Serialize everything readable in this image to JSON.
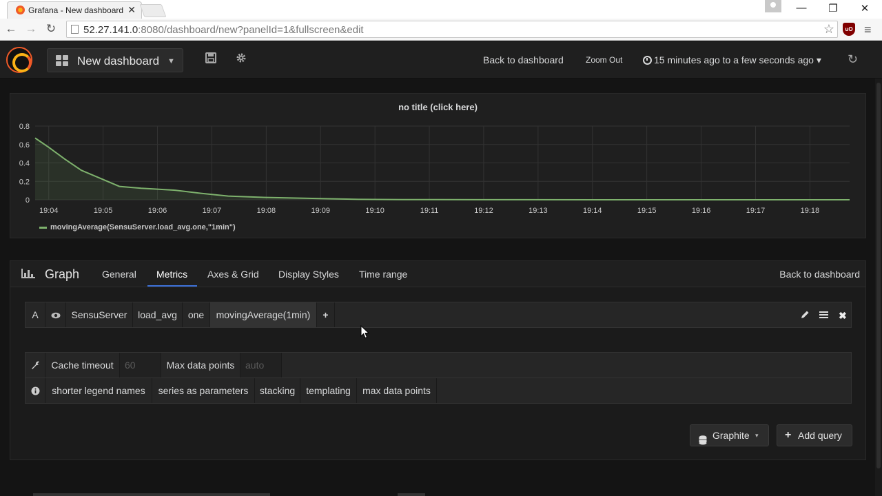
{
  "browser": {
    "tab_title": "Grafana - New dashboard",
    "tab_close": "✕",
    "url_host": "52.27.141.0",
    "url_rest": ":8080/dashboard/new?panelId=1&fullscreen&edit",
    "ublock_label": "uO",
    "window_controls": {
      "minimize": "—",
      "restore": "❐",
      "close": "✕"
    },
    "nav": {
      "back": "←",
      "forward": "→",
      "reload": "↻",
      "star": "☆",
      "menu": "≡"
    }
  },
  "topnav": {
    "dashboard_title": "New dashboard",
    "caret": "▼",
    "save_icon": "floppy-disk-icon",
    "settings_icon": "gear-icon",
    "back_to_dashboard": "Back to dashboard",
    "zoom_out": "Zoom Out",
    "time_range": "15 minutes ago to a few seconds ago",
    "time_caret": "▾",
    "refresh_icon": "↻"
  },
  "panel": {
    "title": "no title (click here)",
    "legend": "movingAverage(SensuServer.load_avg.one,\"1min\")"
  },
  "chart_data": {
    "type": "area",
    "title": "no title (click here)",
    "xlabel": "",
    "ylabel": "",
    "ylim": [
      0,
      0.8
    ],
    "y_ticks": [
      "0",
      "0.2",
      "0.4",
      "0.6",
      "0.8"
    ],
    "x_ticks": [
      "19:04",
      "19:05",
      "19:06",
      "19:07",
      "19:08",
      "19:09",
      "19:10",
      "19:11",
      "19:12",
      "19:13",
      "19:14",
      "19:15",
      "19:16",
      "19:17",
      "19:18"
    ],
    "x_range_minutes": [
      -0.25,
      14.73
    ],
    "grid": true,
    "legend_position": "bottom-left",
    "series": [
      {
        "name": "movingAverage(SensuServer.load_avg.one,\"1min\")",
        "color": "#7eb26d",
        "x": [
          -0.25,
          0.0,
          0.3,
          0.6,
          1.0,
          1.3,
          1.7,
          2.3,
          2.8,
          3.3,
          4.0,
          5.0,
          5.7,
          6.5,
          8.0,
          10.0,
          12.0,
          14.73
        ],
        "y": [
          0.67,
          0.57,
          0.44,
          0.32,
          0.22,
          0.145,
          0.125,
          0.105,
          0.07,
          0.04,
          0.025,
          0.013,
          0.005,
          0.002,
          0.001,
          0.0,
          0.0,
          0.0
        ]
      }
    ]
  },
  "editor": {
    "title": "Graph",
    "tabs": [
      "General",
      "Metrics",
      "Axes & Grid",
      "Display Styles",
      "Time range"
    ],
    "active_tab": "Metrics",
    "back_to_dashboard": "Back to dashboard",
    "query": {
      "ref": "A",
      "segments": [
        "SensuServer",
        "load_avg",
        "one"
      ],
      "function": "movingAverage(1min)",
      "add": "+"
    },
    "options": {
      "cache_timeout_label": "Cache timeout",
      "cache_timeout_placeholder": "60",
      "max_points_label": "Max data points",
      "max_points_placeholder": "auto"
    },
    "help": [
      "shorter legend names",
      "series as parameters",
      "stacking",
      "templating",
      "max data points"
    ],
    "datasource": "Graphite",
    "add_query": "Add query"
  }
}
